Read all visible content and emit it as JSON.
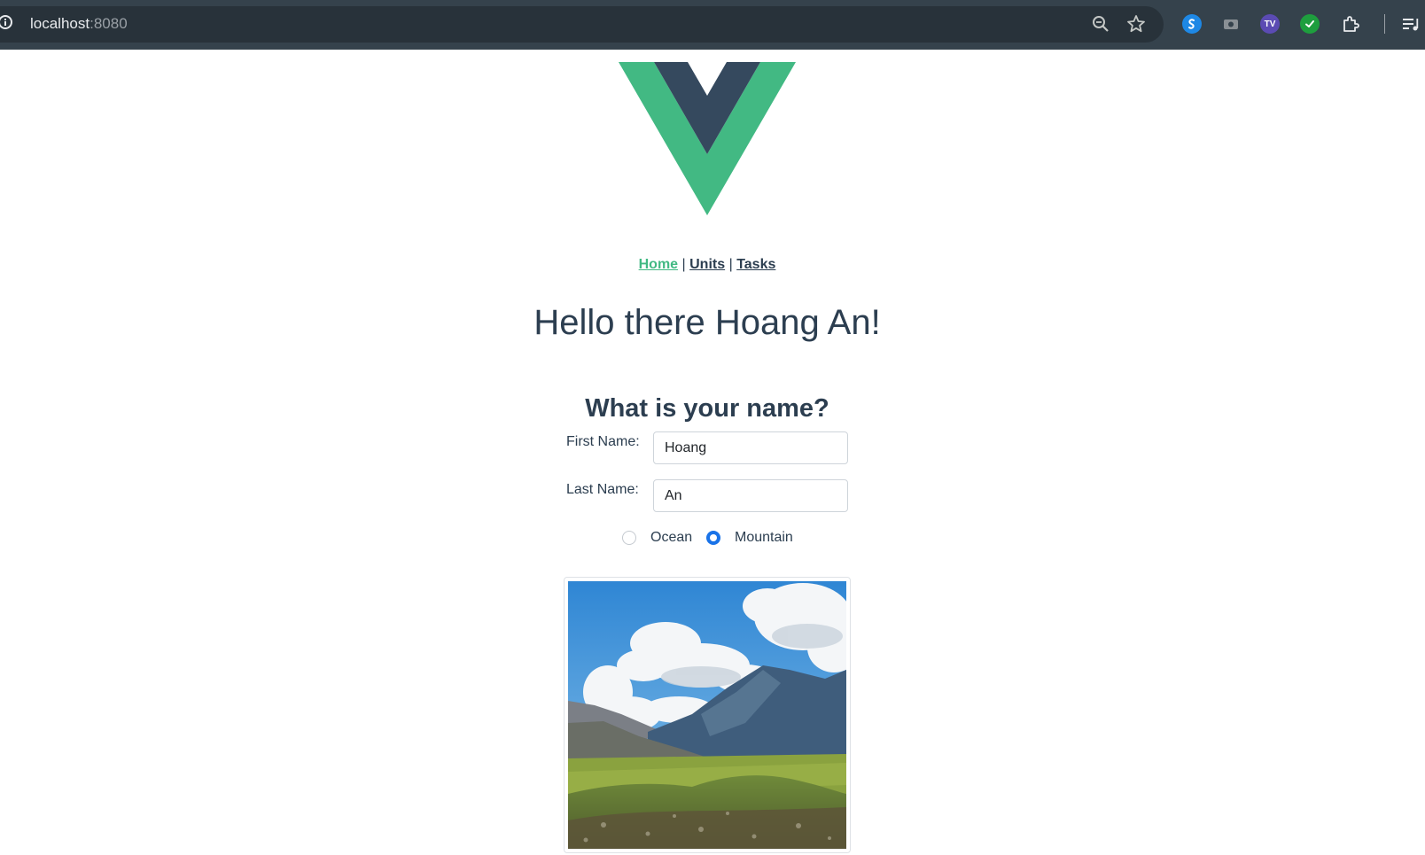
{
  "browser": {
    "url_host": "localhost",
    "url_port": ":8080",
    "icons": [
      "info-icon",
      "zoom-icon",
      "star-icon",
      "shazam-extension-icon",
      "camera-extension-icon",
      "tv-extension-icon",
      "check-extension-icon",
      "extensions-puzzle-icon",
      "media-queue-icon"
    ],
    "tv_badge": "TV"
  },
  "nav": {
    "links": [
      {
        "label": "Home",
        "active": true
      },
      {
        "label": "Units",
        "active": false
      },
      {
        "label": "Tasks",
        "active": false
      }
    ],
    "separator": "|"
  },
  "main": {
    "greeting": "Hello there Hoang An!",
    "question": "What is your name?",
    "form": {
      "first_name_label": "First Name:",
      "first_name_value": "Hoang",
      "last_name_label": "Last Name:",
      "last_name_value": "An",
      "options": [
        {
          "label": "Ocean",
          "selected": false
        },
        {
          "label": "Mountain",
          "selected": true
        }
      ]
    }
  },
  "colors": {
    "vue_green": "#42b983",
    "vue_dark": "#35495e",
    "text": "#2c3e50",
    "radio_selected": "#1a73e8",
    "browser_bar": "#35424c"
  }
}
